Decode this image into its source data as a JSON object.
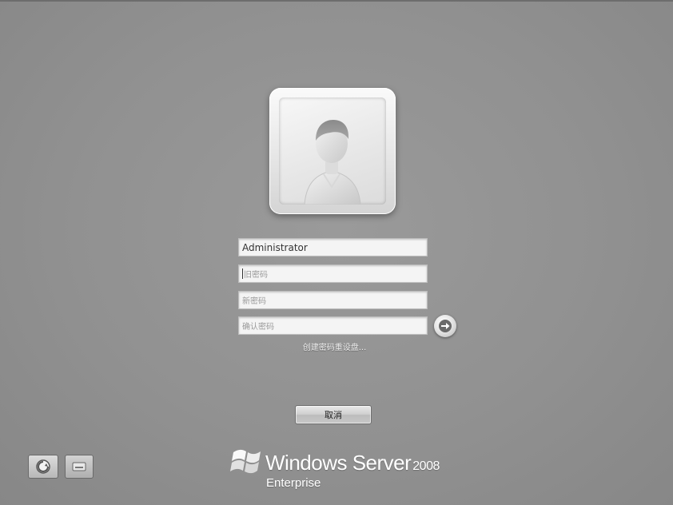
{
  "fields": {
    "username": "Administrator",
    "old_password_placeholder": "旧密码",
    "new_password_placeholder": "新密码",
    "confirm_password_placeholder": "确认密码"
  },
  "links": {
    "create_reset_disk": "创建密码重设盘..."
  },
  "buttons": {
    "cancel": "取消"
  },
  "icons": {
    "submit": "arrow-right-icon",
    "ease_of_access": "ease-of-access-icon",
    "keyboard": "keyboard-icon",
    "user_avatar": "user-silhouette-icon",
    "windows_logo": "windows-flag-icon"
  },
  "branding": {
    "product": "Windows Server",
    "version": "2008",
    "edition": "Enterprise"
  }
}
